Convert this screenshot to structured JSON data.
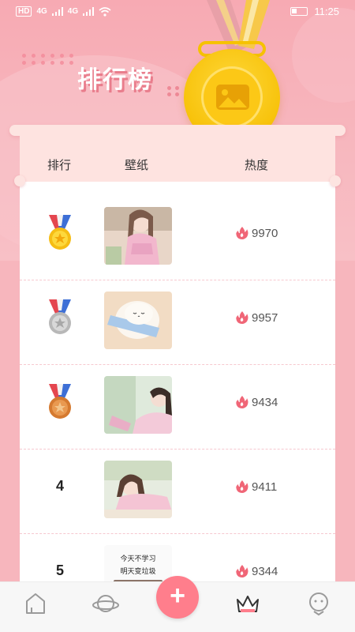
{
  "status_bar": {
    "network_left": "HD",
    "signal_left": "4G",
    "signal_right": "4G",
    "time": "11:25"
  },
  "page": {
    "title": "排行榜"
  },
  "table": {
    "headers": [
      "排行",
      "壁纸",
      "热度"
    ],
    "rows": [
      {
        "rank": "1",
        "medal": "gold-medal-icon",
        "heat": "9970",
        "thumb": "girl-pink-dress"
      },
      {
        "rank": "2",
        "medal": "silver-medal-icon",
        "heat": "9957",
        "thumb": "cute-bun-character"
      },
      {
        "rank": "3",
        "medal": "bronze-medal-icon",
        "heat": "9434",
        "thumb": "girl-garden"
      },
      {
        "rank": "4",
        "medal": "",
        "heat": "9411",
        "thumb": "girl-lying"
      },
      {
        "rank": "5",
        "medal": "",
        "heat": "9344",
        "thumb": "text-note"
      }
    ],
    "thumb_text": [
      "今天不学习",
      "明天变垃圾"
    ]
  },
  "colors": {
    "accent": "#ff7e8c",
    "header_bg": "#fee3e0",
    "page_bg": "#f7b6bd",
    "flame": "#f06677"
  },
  "nav": {
    "items": [
      "home-icon",
      "planet-icon",
      "plus-icon",
      "crown-icon",
      "face-icon"
    ],
    "plus_label": "+"
  }
}
